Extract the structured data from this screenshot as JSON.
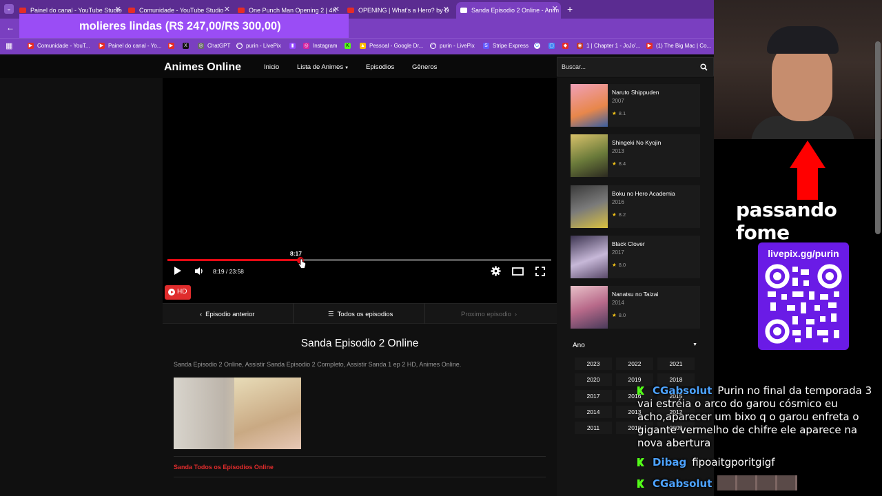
{
  "browser": {
    "tabs": [
      {
        "title": "Painel do canal - YouTube Studio"
      },
      {
        "title": "Comunidade - YouTube Studio"
      },
      {
        "title": "One Punch Man Opening 2 | 4K"
      },
      {
        "title": "OPENING | What's a Hero? by D"
      },
      {
        "title": "Sanda Episodio 2 Online - Anim"
      }
    ],
    "bookmarks": [
      "Comunidade - YouT...",
      "Painel do canal - Yo...",
      "ChatGPT",
      "purin - LivePix",
      "Instagram",
      "Pessoal - Google Dr...",
      "purin - LivePix",
      "Stripe Express",
      "1 | Chapter 1 - JoJo'...",
      "(1) The Big Mac | Co..."
    ]
  },
  "alert": {
    "text": "molieres lindas (R$ 247,00/R$ 300,00)"
  },
  "site": {
    "brand": "Animes Online",
    "nav": [
      "Inicio",
      "Lista de Animes",
      "Episodios",
      "Gêneros"
    ],
    "search_placeholder": "Buscar..."
  },
  "player": {
    "hover_time": "8:17",
    "time": "8:19 / 23:58",
    "progress": 0.347,
    "quality": "HD"
  },
  "episode_nav": {
    "prev": "Episodio anterior",
    "all": "Todos os episodios",
    "next": "Proximo episodio"
  },
  "content": {
    "title": "Sanda Episodio 2 Online",
    "description": "Sanda Episodio 2 Online, Assistir Sanda Episodio 2 Completo, Assistir Sanda 1 ep 2 HD, Animes Online.",
    "all_episodes_link": "Sanda Todos os Episodios Online"
  },
  "sidebar": {
    "animes": [
      {
        "name": "Naruto Shippuden",
        "year": "2007",
        "rating": "8.1"
      },
      {
        "name": "Shingeki No Kyojin",
        "year": "2013",
        "rating": "8.4"
      },
      {
        "name": "Boku no Hero Academia",
        "year": "2016",
        "rating": "8.2"
      },
      {
        "name": "Black Clover",
        "year": "2017",
        "rating": "8.0"
      },
      {
        "name": "Nanatsu no Taizai",
        "year": "2014",
        "rating": "8.0"
      }
    ],
    "year_header": "Ano",
    "years": [
      "2023",
      "2022",
      "2021",
      "2020",
      "2019",
      "2018",
      "2017",
      "2016",
      "2015",
      "2014",
      "2013",
      "2012",
      "2011",
      "2010",
      "2009"
    ]
  },
  "overlay": {
    "caption": "passando fome",
    "livepix_label": "livepix.gg/purin"
  },
  "chat": [
    {
      "user": "CGabsolut",
      "message": "Purin no final da temporada 3 vai estréia o arco do garou cósmico eu acho,aparecer um bixo q o garou enfreta o gigante vermelho de chifre ele aparece na nova abertura"
    },
    {
      "user": "Dibag",
      "message": "fipoaitgporitgigf"
    },
    {
      "user": "CGabsolut",
      "message": ""
    }
  ],
  "colors": {
    "accent": "#e02c2c",
    "browser": "#7a3fc0",
    "kick": "#53fc18"
  }
}
